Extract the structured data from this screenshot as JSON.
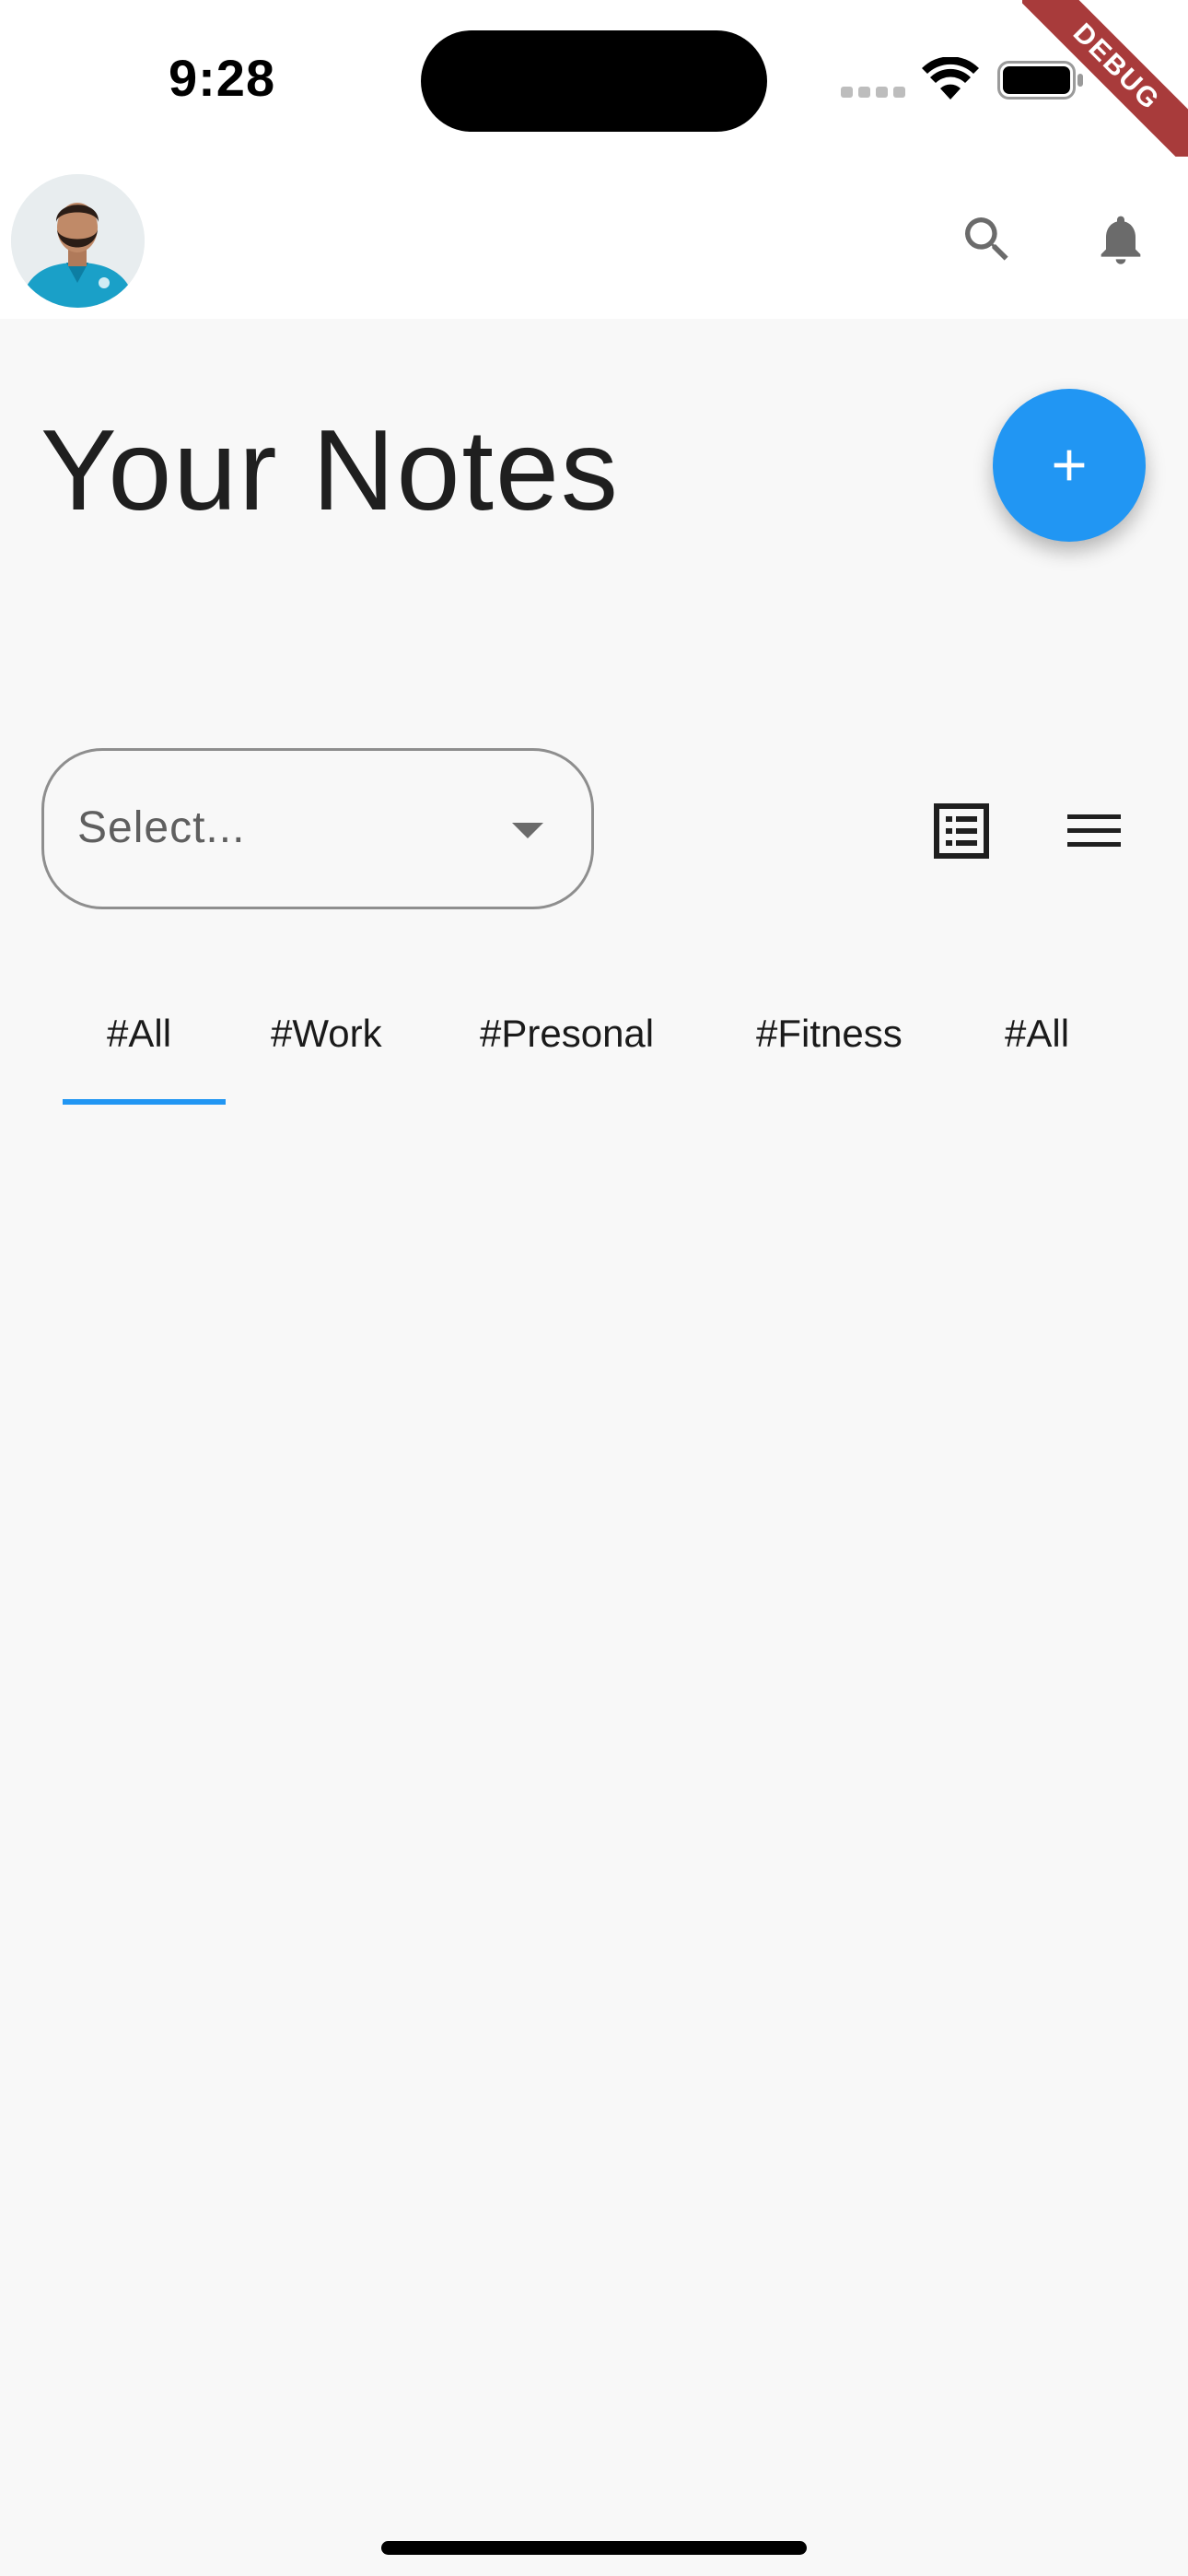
{
  "status_bar": {
    "time": "9:28"
  },
  "debug_banner": "DEBUG",
  "app_bar": {
    "avatar_icon": "profile-photo",
    "search_icon": "search-icon",
    "notification_icon": "bell-icon"
  },
  "main": {
    "title": "Your Notes",
    "fab_icon": "plus-icon",
    "fab_color": "#2196f3",
    "dropdown": {
      "placeholder": "Select..."
    },
    "view_buttons": [
      "grid-view-icon",
      "list-view-icon"
    ],
    "tabs": [
      {
        "label": "#All",
        "selected": true
      },
      {
        "label": "#Work",
        "selected": false
      },
      {
        "label": "#Presonal",
        "selected": false
      },
      {
        "label": "#Fitness",
        "selected": false
      },
      {
        "label": "#All",
        "selected": false
      }
    ],
    "accent_color": "#2196f3"
  }
}
